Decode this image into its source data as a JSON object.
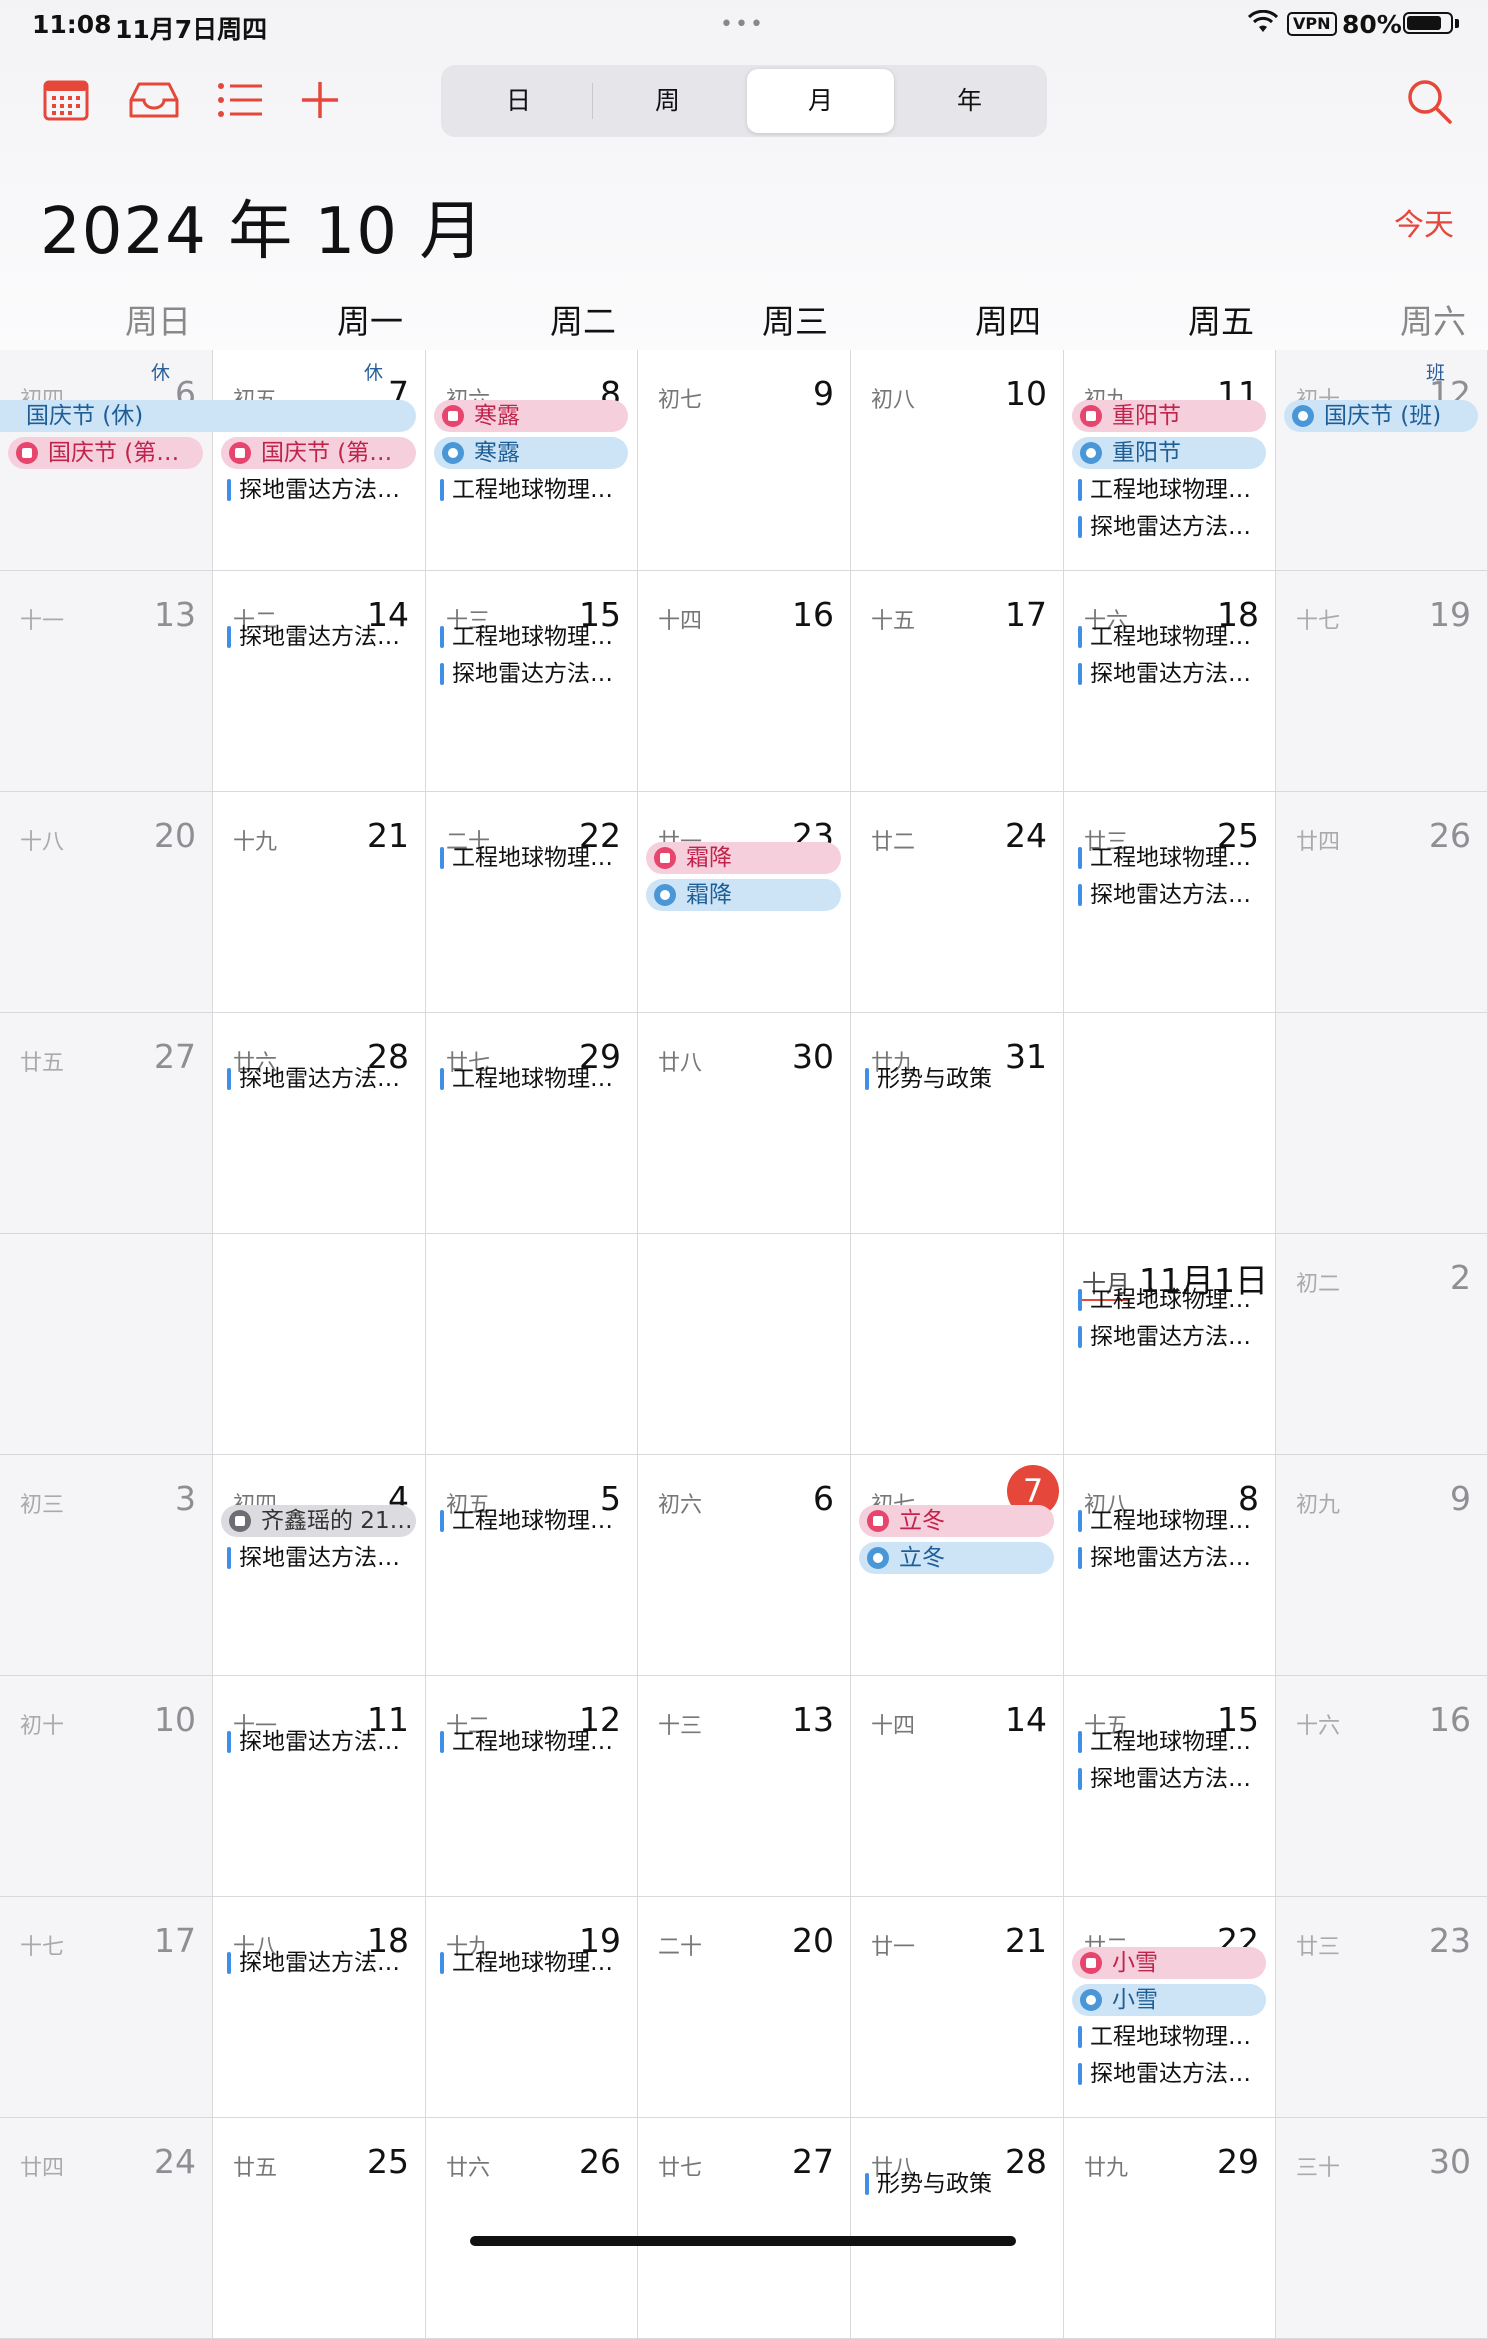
{
  "status": {
    "time": "11:08",
    "date": "11月7日周四",
    "vpn": "VPN",
    "battery": "80%",
    "battery_level": 0.8
  },
  "toolbar": {
    "icons": [
      "calendar-icon",
      "inbox-icon",
      "list-icon",
      "add-icon"
    ],
    "segments": [
      "日",
      "周",
      "月",
      "年"
    ],
    "active_segment": "月"
  },
  "header": {
    "month_title": "2024 年 10 月",
    "today": "今天"
  },
  "weekdays": [
    "周日",
    "周一",
    "周二",
    "周三",
    "周四",
    "周五",
    "周六"
  ],
  "colors": {
    "accent": "#e5483a",
    "holiday_red": "#e6466d",
    "holiday_blue": "#4a97d8",
    "event_bar": "#3f8fe6"
  },
  "weeks": [
    [
      {
        "lunar": "初四",
        "day": "6",
        "badge": "休",
        "items": [
          {
            "type": "span",
            "text": "国庆节 (休)"
          },
          {
            "type": "red",
            "text": "国庆节 (第…"
          }
        ]
      },
      {
        "lunar": "初五",
        "day": "7",
        "badge": "休",
        "items": [
          {
            "type": "spacer"
          },
          {
            "type": "red",
            "text": "国庆节 (第…"
          },
          {
            "type": "ev",
            "text": "探地雷达方法…"
          }
        ]
      },
      {
        "lunar": "初六",
        "day": "8",
        "items": [
          {
            "type": "red",
            "text": "寒露"
          },
          {
            "type": "blue",
            "text": "寒露"
          },
          {
            "type": "ev",
            "text": "工程地球物理…"
          }
        ]
      },
      {
        "lunar": "初七",
        "day": "9",
        "items": []
      },
      {
        "lunar": "初八",
        "day": "10",
        "items": []
      },
      {
        "lunar": "初九",
        "day": "11",
        "items": [
          {
            "type": "red",
            "text": "重阳节"
          },
          {
            "type": "blue",
            "text": "重阳节"
          },
          {
            "type": "ev",
            "text": "工程地球物理…"
          },
          {
            "type": "ev",
            "text": "探地雷达方法…"
          }
        ]
      },
      {
        "lunar": "初十",
        "day": "12",
        "badge": "班",
        "items": [
          {
            "type": "blue",
            "text": "国庆节 (班)"
          }
        ]
      }
    ],
    [
      {
        "lunar": "十一",
        "day": "13",
        "items": []
      },
      {
        "lunar": "十二",
        "day": "14",
        "items": [
          {
            "type": "ev",
            "text": "探地雷达方法…"
          }
        ]
      },
      {
        "lunar": "十三",
        "day": "15",
        "items": [
          {
            "type": "ev",
            "text": "工程地球物理…"
          },
          {
            "type": "ev",
            "text": "探地雷达方法…"
          }
        ]
      },
      {
        "lunar": "十四",
        "day": "16",
        "items": []
      },
      {
        "lunar": "十五",
        "day": "17",
        "items": []
      },
      {
        "lunar": "十六",
        "day": "18",
        "items": [
          {
            "type": "ev",
            "text": "工程地球物理…"
          },
          {
            "type": "ev",
            "text": "探地雷达方法…"
          }
        ]
      },
      {
        "lunar": "十七",
        "day": "19",
        "items": []
      }
    ],
    [
      {
        "lunar": "十八",
        "day": "20",
        "items": []
      },
      {
        "lunar": "十九",
        "day": "21",
        "items": []
      },
      {
        "lunar": "二十",
        "day": "22",
        "items": [
          {
            "type": "ev",
            "text": "工程地球物理…"
          }
        ]
      },
      {
        "lunar": "廿一",
        "day": "23",
        "items": [
          {
            "type": "red",
            "text": "霜降"
          },
          {
            "type": "blue",
            "text": "霜降"
          }
        ]
      },
      {
        "lunar": "廿二",
        "day": "24",
        "items": []
      },
      {
        "lunar": "廿三",
        "day": "25",
        "items": [
          {
            "type": "ev",
            "text": "工程地球物理…"
          },
          {
            "type": "ev",
            "text": "探地雷达方法…"
          }
        ]
      },
      {
        "lunar": "廿四",
        "day": "26",
        "items": []
      }
    ],
    [
      {
        "lunar": "廿五",
        "day": "27",
        "items": []
      },
      {
        "lunar": "廿六",
        "day": "28",
        "items": [
          {
            "type": "ev",
            "text": "探地雷达方法…"
          }
        ]
      },
      {
        "lunar": "廿七",
        "day": "29",
        "items": [
          {
            "type": "ev",
            "text": "工程地球物理…"
          }
        ]
      },
      {
        "lunar": "廿八",
        "day": "30",
        "items": []
      },
      {
        "lunar": "廿九",
        "day": "31",
        "items": [
          {
            "type": "ev",
            "text": "形势与政策"
          }
        ]
      },
      {
        "lunar": "",
        "day": "",
        "items": []
      },
      {
        "lunar": "",
        "day": "",
        "items": []
      }
    ],
    [
      {
        "lunar": "",
        "day": "",
        "items": []
      },
      {
        "lunar": "",
        "day": "",
        "items": []
      },
      {
        "lunar": "",
        "day": "",
        "items": []
      },
      {
        "lunar": "",
        "day": "",
        "items": []
      },
      {
        "lunar": "",
        "day": "",
        "items": []
      },
      {
        "lunar": "十月",
        "day": "",
        "month_label": "11月1日",
        "items": [
          {
            "type": "ev",
            "text": "工程地球物理…"
          },
          {
            "type": "ev",
            "text": "探地雷达方法…"
          }
        ]
      },
      {
        "lunar": "初二",
        "day": "2",
        "items": []
      }
    ],
    [
      {
        "lunar": "初三",
        "day": "3",
        "items": []
      },
      {
        "lunar": "初四",
        "day": "4",
        "items": [
          {
            "type": "gray",
            "text": "齐鑫瑶的 21…"
          },
          {
            "type": "ev",
            "text": "探地雷达方法…"
          }
        ]
      },
      {
        "lunar": "初五",
        "day": "5",
        "items": [
          {
            "type": "ev",
            "text": "工程地球物理…"
          }
        ]
      },
      {
        "lunar": "初六",
        "day": "6",
        "items": []
      },
      {
        "lunar": "初七",
        "day": "7",
        "today": true,
        "items": [
          {
            "type": "red",
            "text": "立冬"
          },
          {
            "type": "blue",
            "text": "立冬"
          }
        ]
      },
      {
        "lunar": "初八",
        "day": "8",
        "items": [
          {
            "type": "ev",
            "text": "工程地球物理…"
          },
          {
            "type": "ev",
            "text": "探地雷达方法…"
          }
        ]
      },
      {
        "lunar": "初九",
        "day": "9",
        "items": []
      }
    ],
    [
      {
        "lunar": "初十",
        "day": "10",
        "items": []
      },
      {
        "lunar": "十一",
        "day": "11",
        "items": [
          {
            "type": "ev",
            "text": "探地雷达方法…"
          }
        ]
      },
      {
        "lunar": "十二",
        "day": "12",
        "items": [
          {
            "type": "ev",
            "text": "工程地球物理…"
          }
        ]
      },
      {
        "lunar": "十三",
        "day": "13",
        "items": []
      },
      {
        "lunar": "十四",
        "day": "14",
        "items": []
      },
      {
        "lunar": "十五",
        "day": "15",
        "items": [
          {
            "type": "ev",
            "text": "工程地球物理…"
          },
          {
            "type": "ev",
            "text": "探地雷达方法…"
          }
        ]
      },
      {
        "lunar": "十六",
        "day": "16",
        "items": []
      }
    ],
    [
      {
        "lunar": "十七",
        "day": "17",
        "items": []
      },
      {
        "lunar": "十八",
        "day": "18",
        "items": [
          {
            "type": "ev",
            "text": "探地雷达方法…"
          }
        ]
      },
      {
        "lunar": "十九",
        "day": "19",
        "items": [
          {
            "type": "ev",
            "text": "工程地球物理…"
          }
        ]
      },
      {
        "lunar": "二十",
        "day": "20",
        "items": []
      },
      {
        "lunar": "廿一",
        "day": "21",
        "items": []
      },
      {
        "lunar": "廿二",
        "day": "22",
        "items": [
          {
            "type": "red",
            "text": "小雪"
          },
          {
            "type": "blue",
            "text": "小雪"
          },
          {
            "type": "ev",
            "text": "工程地球物理…"
          },
          {
            "type": "ev",
            "text": "探地雷达方法…"
          }
        ]
      },
      {
        "lunar": "廿三",
        "day": "23",
        "items": []
      }
    ],
    [
      {
        "lunar": "廿四",
        "day": "24",
        "items": []
      },
      {
        "lunar": "廿五",
        "day": "25",
        "items": []
      },
      {
        "lunar": "廿六",
        "day": "26",
        "items": []
      },
      {
        "lunar": "廿七",
        "day": "27",
        "items": []
      },
      {
        "lunar": "廿八",
        "day": "28",
        "items": [
          {
            "type": "ev",
            "text": "形势与政策"
          }
        ]
      },
      {
        "lunar": "廿九",
        "day": "29",
        "items": []
      },
      {
        "lunar": "三十",
        "day": "30",
        "items": []
      }
    ]
  ]
}
